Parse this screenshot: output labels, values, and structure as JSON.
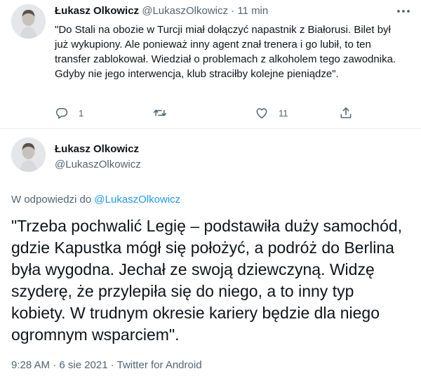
{
  "tweet1": {
    "display_name": "Łukasz Olkowicz",
    "handle": "@LukaszOlkowicz",
    "separator": "·",
    "time_ago": "11 min",
    "text": "\"Do Stali na obozie w Turcji miał dołączyć napastnik z Białorusi. Bilet był już wykupiony. Ale ponieważ inny agent znał trenera i go lubił, to ten transfer zablokował. Wiedział o problemach z alkoholem tego zawodnika. Gdyby nie jego interwencja, klub straciłby kolejne pieniądze\".",
    "actions": {
      "reply_count": "1",
      "retweet_count": "",
      "like_count": "11"
    },
    "icons": [
      "reply-icon",
      "retweet-icon",
      "like-icon",
      "share-icon",
      "more-icon"
    ]
  },
  "tweet2": {
    "display_name": "Łukasz Olkowicz",
    "handle": "@LukaszOlkowicz",
    "reply_prefix": "W odpowiedzi do",
    "reply_to_handle": "@LukaszOlkowicz",
    "text": "\"Trzeba pochwalić Legię – podstawiła duży samochód, gdzie Kapustka mógł się położyć, a podróż do Berlina była wygodna. Jechał ze swoją dziewczyną. Widzę szyderę, że przylepiła się do niego, a to inny typ kobiety. W trudnym okresie kariery będzie dla niego ogromnym wsparciem\".",
    "meta": "9:28 AM · 6 sie 2021 · Twitter for Android"
  },
  "colors": {
    "text_primary": "#0f1419",
    "text_secondary": "#536471",
    "link": "#1d9bf0",
    "divider": "#e6ecf0"
  }
}
